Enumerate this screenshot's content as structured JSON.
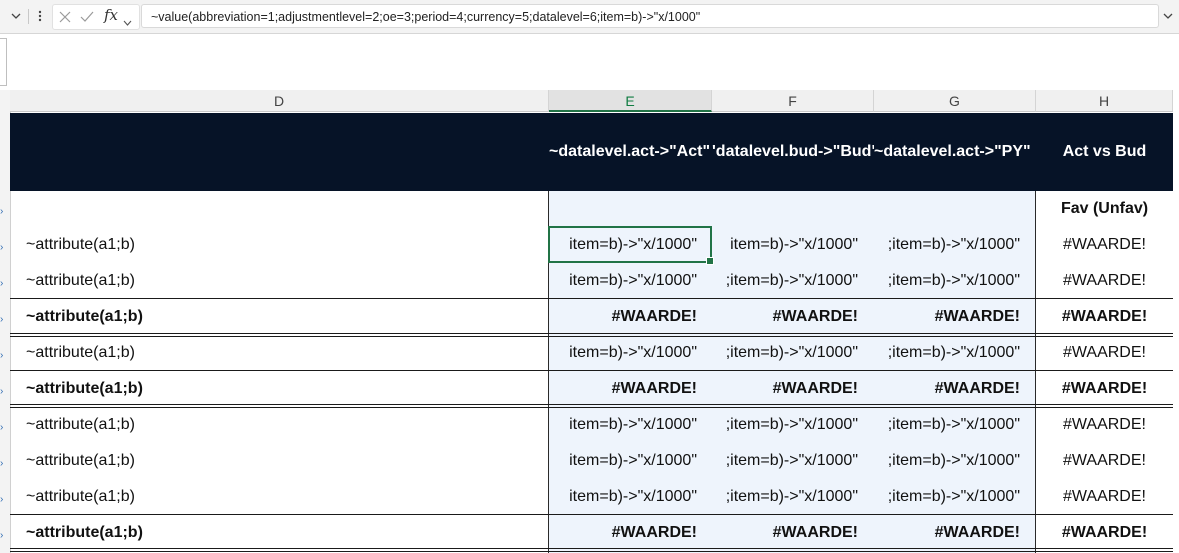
{
  "formula_bar": {
    "collapse_icon": "chevron-down-icon",
    "more_icon": "vertical-ellipsis-icon",
    "cancel_icon": "x-icon",
    "enter_icon": "check-icon",
    "fx_label": "fx",
    "formula": "~value(abbreviation=1;adjustmentlevel=2;oe=3;period=4;currency=5;datalevel=6;item=b)->\"x/1000\""
  },
  "columns": [
    "D",
    "E",
    "F",
    "G",
    "H"
  ],
  "header_band": {
    "e": "~datalevel.act->\"Act\"",
    "f": "'datalevel.bud->\"Bud\"",
    "g": "~datalevel.act->\"PY\"",
    "h": "Act vs Bud"
  },
  "subheader": {
    "h": "Fav (Unfav)"
  },
  "rows": [
    {
      "label": "~attribute(a1;b)",
      "bold": false,
      "e": "item=b)->\"x/1000\"",
      "f": "item=b)->\"x/1000\"",
      "g": ";item=b)->\"x/1000\"",
      "h": "#WAARDE!"
    },
    {
      "label": "~attribute(a1;b)",
      "bold": false,
      "e": "item=b)->\"x/1000\"",
      "f": ";item=b)->\"x/1000\"",
      "g": ";item=b)->\"x/1000\"",
      "h": "#WAARDE!"
    },
    {
      "label": "~attribute(a1;b)",
      "bold": true,
      "e": "#WAARDE!",
      "f": "#WAARDE!",
      "g": "#WAARDE!",
      "h": "#WAARDE!"
    },
    {
      "label": "~attribute(a1;b)",
      "bold": false,
      "e": "item=b)->\"x/1000\"",
      "f": ";item=b)->\"x/1000\"",
      "g": ";item=b)->\"x/1000\"",
      "h": "#WAARDE!"
    },
    {
      "label": "~attribute(a1;b)",
      "bold": true,
      "e": "#WAARDE!",
      "f": "#WAARDE!",
      "g": "#WAARDE!",
      "h": "#WAARDE!"
    },
    {
      "label": "~attribute(a1;b)",
      "bold": false,
      "e": "item=b)->\"x/1000\"",
      "f": ";item=b)->\"x/1000\"",
      "g": ";item=b)->\"x/1000\"",
      "h": "#WAARDE!"
    },
    {
      "label": "~attribute(a1;b)",
      "bold": false,
      "e": "item=b)->\"x/1000\"",
      "f": ";item=b)->\"x/1000\"",
      "g": ";item=b)->\"x/1000\"",
      "h": "#WAARDE!"
    },
    {
      "label": "~attribute(a1;b)",
      "bold": false,
      "e": "item=b)->\"x/1000\"",
      "f": ";item=b)->\"x/1000\"",
      "g": ";item=b)->\"x/1000\"",
      "h": "#WAARDE!"
    },
    {
      "label": "~attribute(a1;b)",
      "bold": true,
      "e": "#WAARDE!",
      "f": "#WAARDE!",
      "g": "#WAARDE!",
      "h": "#WAARDE!"
    }
  ],
  "colors": {
    "band": "#061327",
    "accent": "#217346",
    "shade": "#eef4fc"
  }
}
